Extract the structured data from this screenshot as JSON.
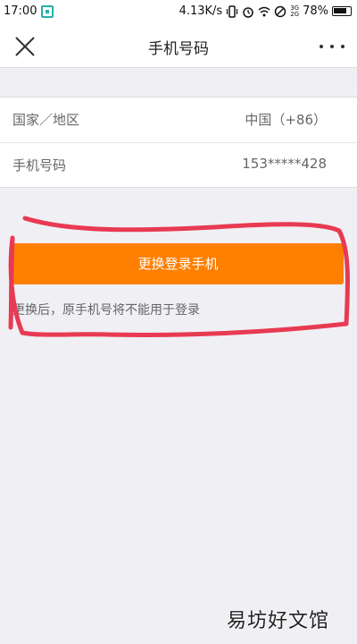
{
  "status_bar": {
    "time": "17:00",
    "network_speed": "4.13K/s",
    "signal_labels": [
      "3G",
      "2G"
    ],
    "battery": "78%",
    "icons": [
      "qr-scan-icon",
      "vibrate-icon",
      "alarm-icon",
      "wifi-icon",
      "no-disturb-icon",
      "signal-icon",
      "battery-icon"
    ]
  },
  "nav": {
    "title": "手机号码",
    "close_icon": "close-icon",
    "more_icon": "more-icon"
  },
  "info": {
    "region_label": "国家／地区",
    "region_value": "中国（+86）",
    "phone_label": "手机号码",
    "phone_value": "153*****428"
  },
  "action": {
    "button_label": "更换登录手机",
    "button_color": "#ff7f00",
    "hint": "更换后，原手机号将不能用于登录"
  },
  "annotation": {
    "color": "#e83a52"
  },
  "watermark": "易坊好文馆"
}
